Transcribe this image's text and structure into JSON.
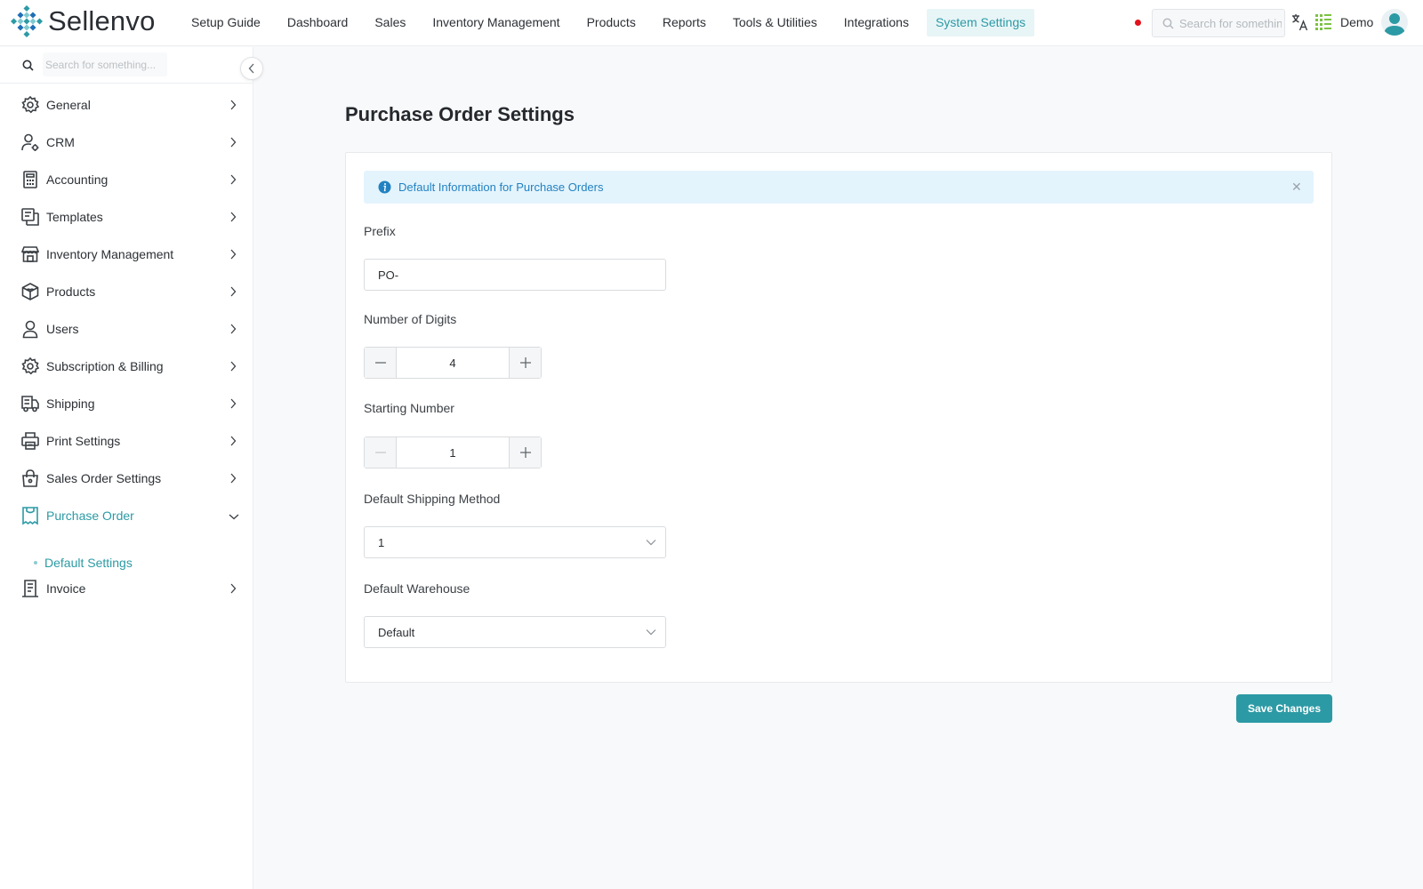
{
  "app": {
    "name": "Sellenvo"
  },
  "nav": {
    "items": [
      "Setup Guide",
      "Dashboard",
      "Sales",
      "Inventory Management",
      "Products",
      "Reports",
      "Tools & Utilities",
      "Integrations",
      "System Settings"
    ],
    "active": "System Settings"
  },
  "header": {
    "search_placeholder": "Search for something...",
    "user_name": "Demo",
    "recording_color": "#e3121b"
  },
  "sidebar": {
    "search_placeholder": "Search for something...",
    "items": [
      {
        "label": "General",
        "icon": "gear-icon"
      },
      {
        "label": "CRM",
        "icon": "user-gear-icon"
      },
      {
        "label": "Accounting",
        "icon": "calculator-icon"
      },
      {
        "label": "Templates",
        "icon": "templates-icon"
      },
      {
        "label": "Inventory Management",
        "icon": "store-icon"
      },
      {
        "label": "Products",
        "icon": "box-icon"
      },
      {
        "label": "Users",
        "icon": "user-icon"
      },
      {
        "label": "Subscription & Billing",
        "icon": "gear-icon"
      },
      {
        "label": "Shipping",
        "icon": "truck-icon"
      },
      {
        "label": "Print Settings",
        "icon": "printer-icon"
      },
      {
        "label": "Sales Order Settings",
        "icon": "shopping-bag-icon"
      },
      {
        "label": "Purchase Order",
        "icon": "receipt-icon",
        "expanded": true
      },
      {
        "label": "Invoice",
        "icon": "invoice-icon"
      }
    ],
    "sub_items": [
      {
        "label": "Default Settings",
        "active": true
      }
    ]
  },
  "main": {
    "title": "Purchase Order Settings",
    "alert": "Default Information for Purchase Orders",
    "fields": {
      "prefix": {
        "label": "Prefix",
        "value": "PO-"
      },
      "digits": {
        "label": "Number of Digits",
        "value": "4"
      },
      "starting": {
        "label": "Starting Number",
        "value": "1"
      },
      "shipping": {
        "label": "Default Shipping Method",
        "value": "1"
      },
      "warehouse": {
        "label": "Default Warehouse",
        "value": "Default"
      }
    },
    "save_label": "Save Changes"
  },
  "colors": {
    "accent": "#2c9aa5",
    "info_bg": "#e4f4fd",
    "info_text": "#2282c1"
  }
}
